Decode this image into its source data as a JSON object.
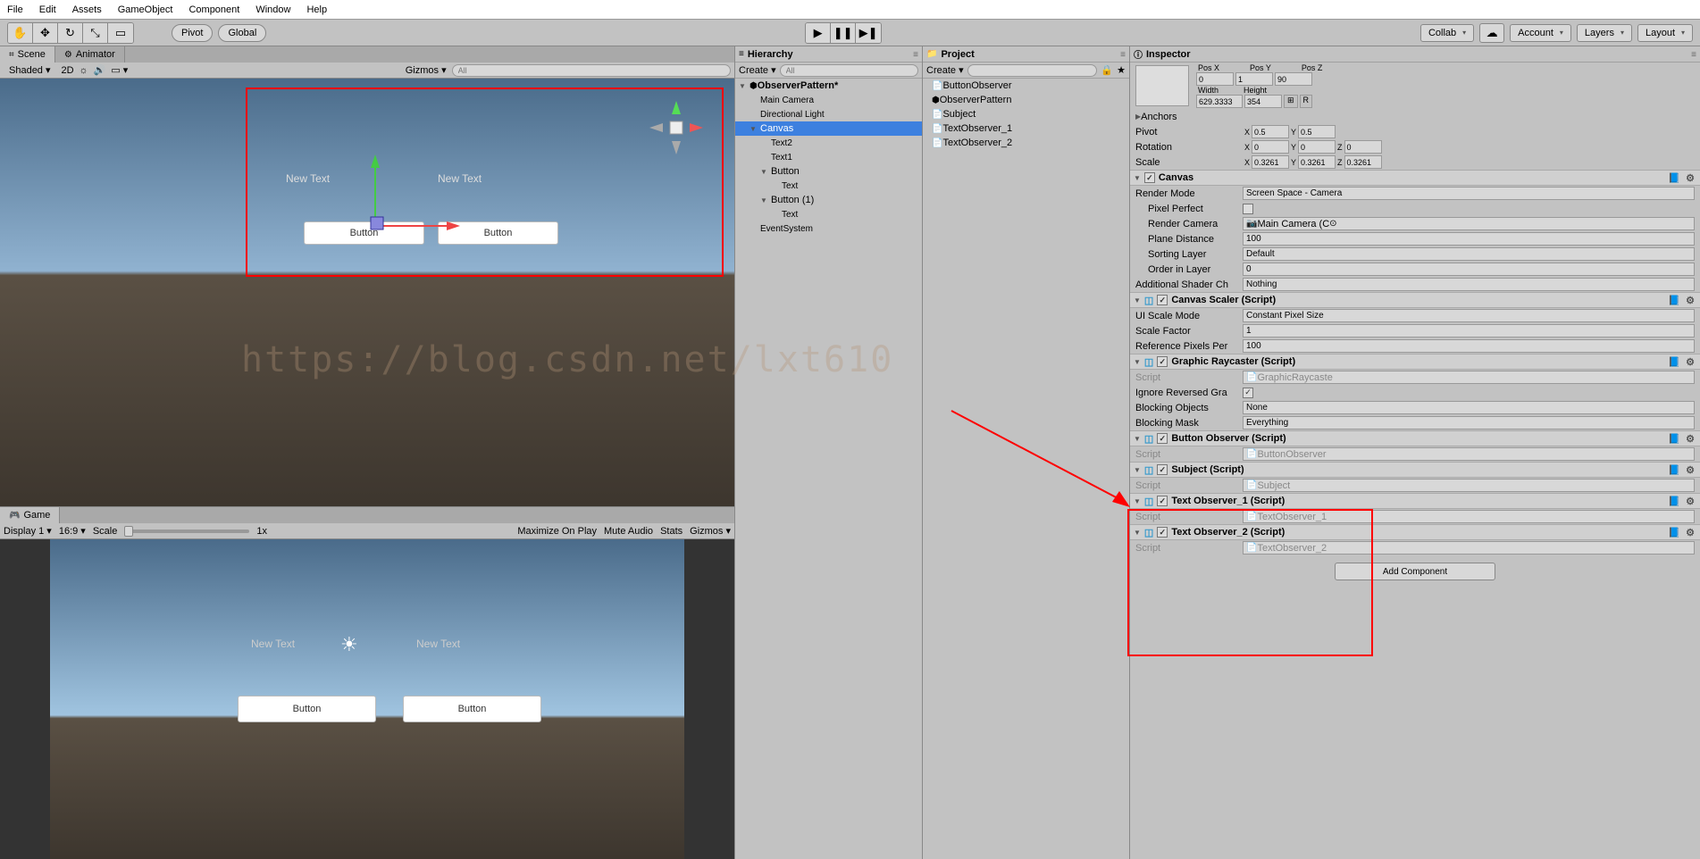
{
  "menu": {
    "items": [
      "File",
      "Edit",
      "Assets",
      "GameObject",
      "Component",
      "Window",
      "Help"
    ]
  },
  "toolbar": {
    "pivot": "Pivot",
    "global": "Global",
    "collab": "Collab",
    "account": "Account",
    "layers": "Layers",
    "layout": "Layout"
  },
  "scene": {
    "tab": "Scene",
    "animator_tab": "Animator",
    "shaded": "Shaded",
    "dim": "2D",
    "gizmos": "Gizmos",
    "search_ph": "All",
    "text1": "New Text",
    "text2": "New Text",
    "btn1": "Button",
    "btn2": "Button"
  },
  "game": {
    "tab": "Game",
    "display": "Display 1",
    "aspect": "16:9",
    "scale": "Scale",
    "scale_val": "1x",
    "maximize": "Maximize On Play",
    "mute": "Mute Audio",
    "stats": "Stats",
    "giz": "Gizmos",
    "text1": "New Text",
    "text2": "New Text",
    "btn1": "Button",
    "btn2": "Button"
  },
  "hierarchy": {
    "title": "Hierarchy",
    "create": "Create",
    "search_ph": "All",
    "root": "ObserverPattern*",
    "items": [
      "Main Camera",
      "Directional Light",
      "Canvas",
      "Text2",
      "Text1",
      "Button",
      "Text",
      "Button (1)",
      "Text",
      "EventSystem"
    ]
  },
  "project": {
    "title": "Project",
    "create": "Create",
    "search_ph": "",
    "items": [
      "ButtonObserver",
      "ObserverPattern",
      "Subject",
      "TextObserver_1",
      "TextObserver_2"
    ]
  },
  "inspector": {
    "title": "Inspector",
    "pos": {
      "x": "0",
      "y": "1",
      "z": "90",
      "lblx": "Pos X",
      "lbly": "Pos Y",
      "lblz": "Pos Z"
    },
    "size": {
      "wlbl": "Width",
      "hlbl": "Height",
      "w": "629.3333",
      "h": "354"
    },
    "anchors": "Anchors",
    "pivot": "Pivot",
    "pivot_x": "0.5",
    "pivot_y": "0.5",
    "rotation": "Rotation",
    "rx": "0",
    "ry": "0",
    "rz": "0",
    "scale": "Scale",
    "sx": "0.3261",
    "sy": "0.3261",
    "sz": "0.3261",
    "canvas": {
      "title": "Canvas",
      "render_mode_lbl": "Render Mode",
      "render_mode": "Screen Space - Camera",
      "pixel_perfect": "Pixel Perfect",
      "render_camera_lbl": "Render Camera",
      "render_camera": "Main Camera (C",
      "plane_distance_lbl": "Plane Distance",
      "plane_distance": "100",
      "sorting_layer_lbl": "Sorting Layer",
      "sorting_layer": "Default",
      "order_lbl": "Order in Layer",
      "order": "0",
      "shader_lbl": "Additional Shader Ch",
      "shader": "Nothing"
    },
    "scaler": {
      "title": "Canvas Scaler (Script)",
      "mode_lbl": "UI Scale Mode",
      "mode": "Constant Pixel Size",
      "factor_lbl": "Scale Factor",
      "factor": "1",
      "ref_lbl": "Reference Pixels Per",
      "ref": "100"
    },
    "raycaster": {
      "title": "Graphic Raycaster (Script)",
      "script_lbl": "Script",
      "script": "GraphicRaycaste",
      "ignore_lbl": "Ignore Reversed Gra",
      "blocking_lbl": "Blocking Objects",
      "blocking": "None",
      "mask_lbl": "Blocking Mask",
      "mask": "Everything"
    },
    "btn_obs": {
      "title": "Button Observer (Script)",
      "script_lbl": "Script",
      "script": "ButtonObserver"
    },
    "subject": {
      "title": "Subject (Script)",
      "script_lbl": "Script",
      "script": "Subject"
    },
    "txt1": {
      "title": "Text Observer_1 (Script)",
      "script_lbl": "Script",
      "script": "TextObserver_1"
    },
    "txt2": {
      "title": "Text Observer_2 (Script)",
      "script_lbl": "Script",
      "script": "TextObserver_2"
    },
    "add_comp": "Add Component"
  },
  "watermark": "https://blog.csdn.net/lxt610"
}
